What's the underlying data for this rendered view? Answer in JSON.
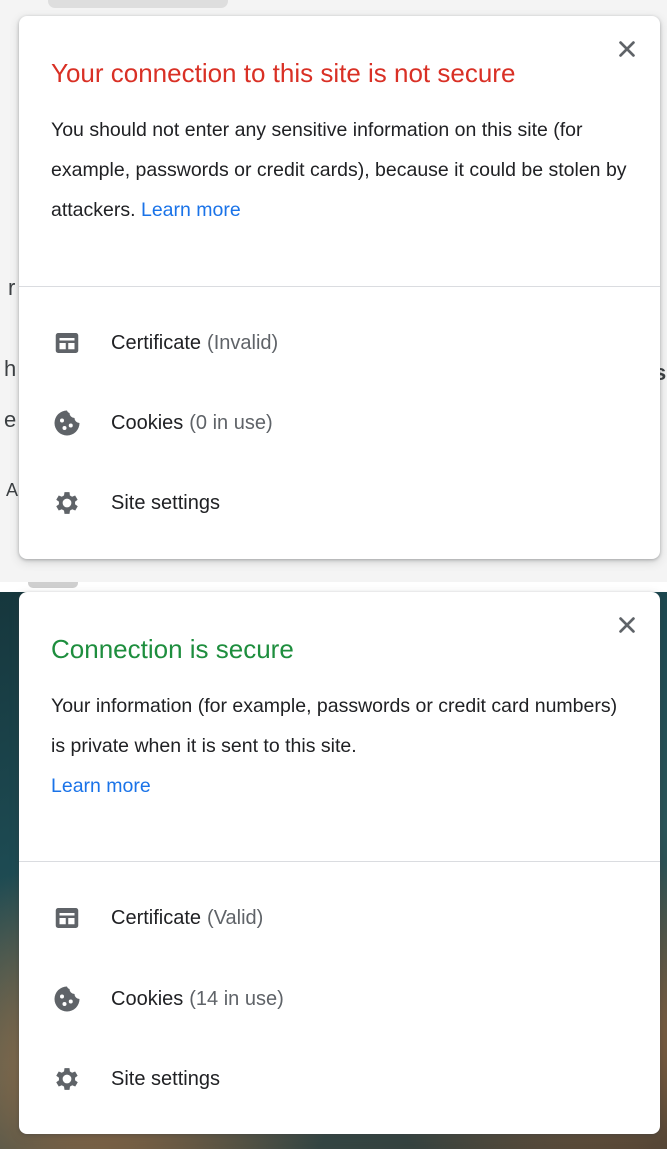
{
  "colors": {
    "insecure_title": "#d93025",
    "secure_title": "#1e8e3e",
    "link": "#1a73e8",
    "text": "#202124",
    "muted": "#5f6368",
    "icon": "#5f6368"
  },
  "background_fragments": [
    "r",
    "h",
    "s",
    "e",
    "A"
  ],
  "insecure_popup": {
    "title": "Your connection to this site is not secure",
    "message": "You should not enter any sensitive information on this site (for example, passwords or credit cards), because it could be stolen by attackers.",
    "learn_more": "Learn more",
    "close_icon": "close-icon",
    "items": [
      {
        "icon": "certificate-icon",
        "label": "Certificate",
        "detail": "(Invalid)"
      },
      {
        "icon": "cookie-icon",
        "label": "Cookies",
        "detail": "(0 in use)"
      },
      {
        "icon": "gear-icon",
        "label": "Site settings",
        "detail": ""
      }
    ]
  },
  "secure_popup": {
    "title": "Connection is secure",
    "message": "Your information (for example, passwords or credit card numbers) is private when it is sent to this site.",
    "learn_more": "Learn more",
    "close_icon": "close-icon",
    "items": [
      {
        "icon": "certificate-icon",
        "label": "Certificate",
        "detail": "(Valid)"
      },
      {
        "icon": "cookie-icon",
        "label": "Cookies",
        "detail": "(14 in use)"
      },
      {
        "icon": "gear-icon",
        "label": "Site settings",
        "detail": ""
      }
    ]
  }
}
